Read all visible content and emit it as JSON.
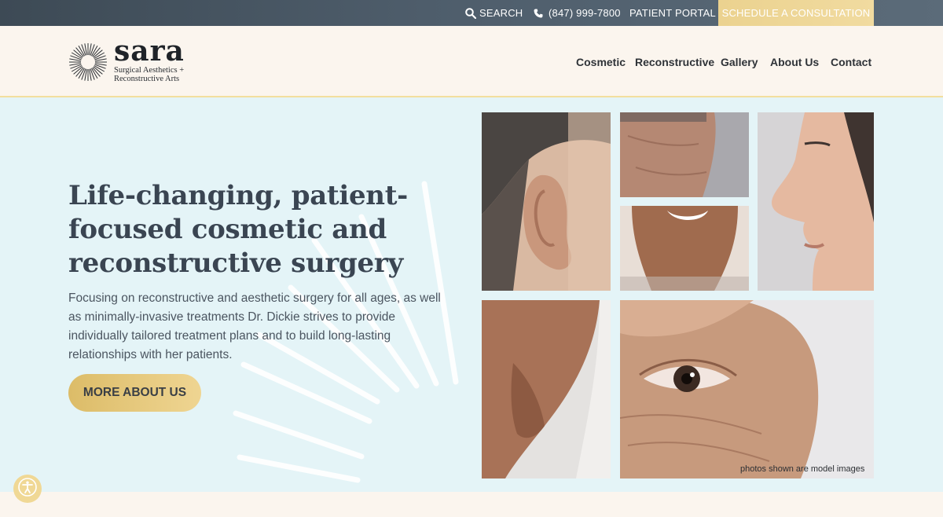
{
  "topbar": {
    "search_label": "SEARCH",
    "phone": "(847) 999-7800",
    "portal_label": "PATIENT PORTAL",
    "cta_label": "SCHEDULE A CONSULTATION"
  },
  "brand": {
    "name": "sara",
    "tagline_line1": "Surgical Aesthetics +",
    "tagline_line2": "Reconstructive Arts"
  },
  "nav": {
    "items": [
      {
        "label": "Cosmetic"
      },
      {
        "label": "Reconstructive"
      },
      {
        "label": "Gallery"
      },
      {
        "label": "About Us"
      },
      {
        "label": "Contact"
      }
    ]
  },
  "hero": {
    "title": "Life-changing, patient-focused cosmetic and reconstructive surgery",
    "description": "Focusing on reconstructive and aesthetic surgery for all ages, as well as minimally-invasive treatments Dr. Dickie strives to provide individually tailored treatment plans and to build long-lasting relationships with her patients.",
    "button_label": "MORE ABOUT US",
    "photo_caption": "photos shown are model images"
  },
  "icons": {
    "search": "search-icon",
    "phone": "phone-icon",
    "accessibility": "accessibility-icon"
  },
  "colors": {
    "topbar": "#4e5d6b",
    "accent_gold": "#efd592",
    "hero_bg": "#e4f4f7",
    "header_bg": "#fbf5ee",
    "heading": "#3a4552"
  }
}
